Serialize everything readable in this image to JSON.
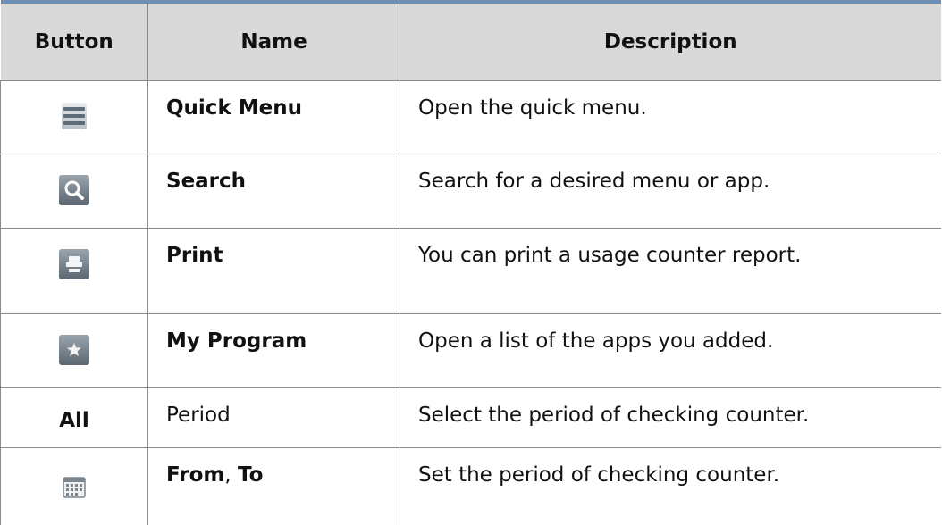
{
  "table": {
    "headers": {
      "button": "Button",
      "name": "Name",
      "description": "Description"
    },
    "rows": [
      {
        "icon": "quick-menu-icon",
        "name": "Quick Menu",
        "description": "Open the quick menu."
      },
      {
        "icon": "search-icon",
        "name": "Search",
        "description": "Search for a desired menu or app."
      },
      {
        "icon": "print-icon",
        "name": "Print",
        "description": "You can print a usage counter report."
      },
      {
        "icon": "star-icon",
        "name": "My Program",
        "description": "Open a list of the apps you added."
      },
      {
        "button_text": "All",
        "name": "Period",
        "description": "Select the period of checking counter."
      },
      {
        "icon": "calendar-icon",
        "name_from": "From",
        "name_sep": ", ",
        "name_to": "To",
        "description": "Set the period of checking counter."
      }
    ]
  },
  "colors": {
    "header_background": "#d9d9d9",
    "header_top_rule": "#6d8fb6",
    "cell_border": "#8a8a8a",
    "icon_dark": "#5b6670"
  }
}
